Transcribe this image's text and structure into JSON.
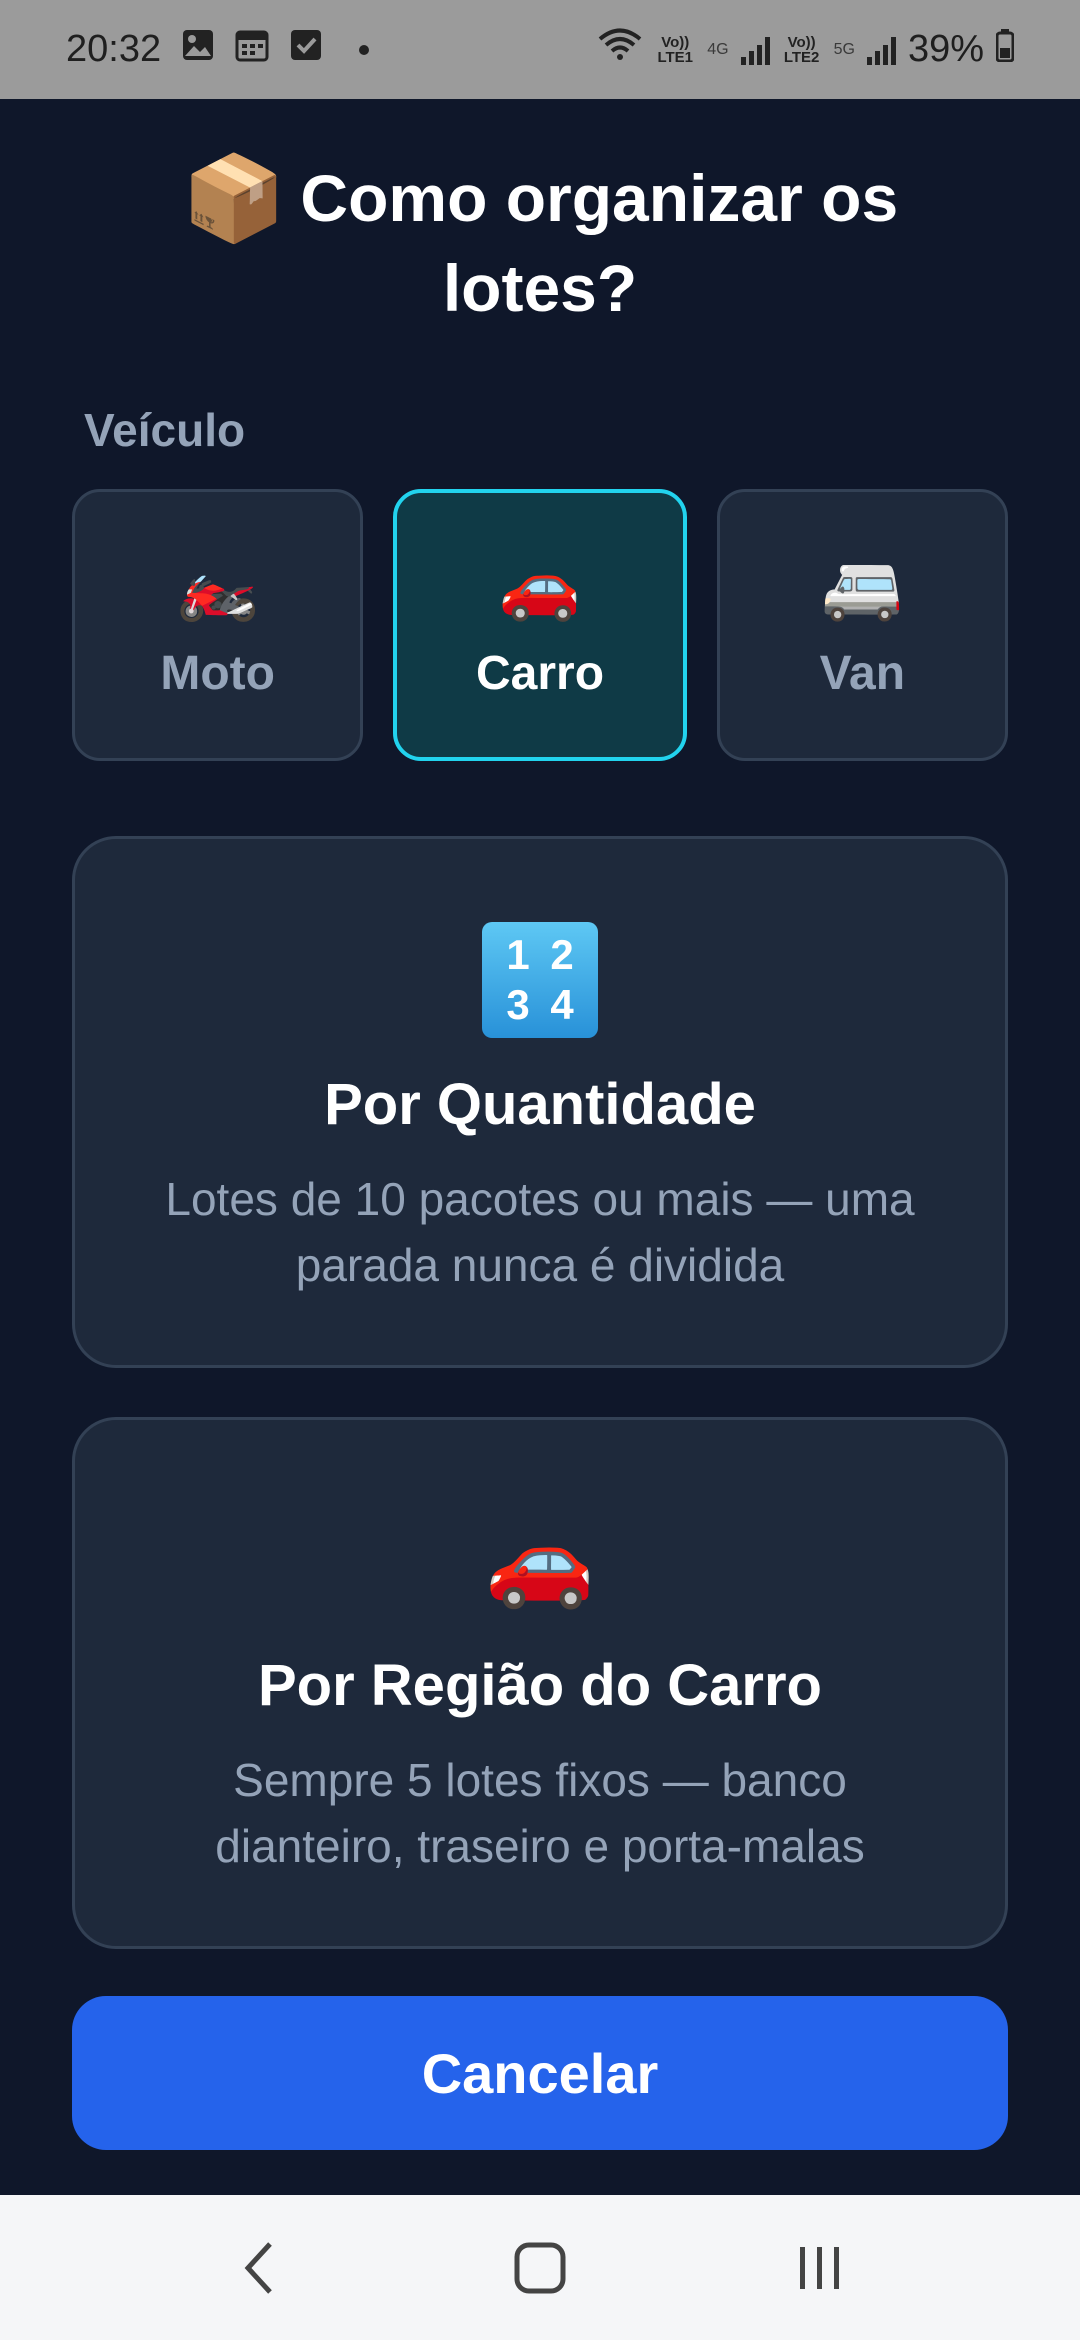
{
  "status_bar": {
    "time": "20:32",
    "left_icons": [
      "gallery-icon",
      "calendar-icon",
      "checkbox-icon",
      "dot-icon"
    ],
    "volte1": "Vo)) LTE1",
    "net1": "4G",
    "volte2": "Vo)) LTE2",
    "net2": "5G",
    "battery": "39%"
  },
  "header": {
    "emoji": "📦",
    "title": "Como organizar os lotes?"
  },
  "vehicle_section": {
    "label": "Veículo",
    "options": [
      {
        "emoji": "🏍️",
        "label": "Moto",
        "selected": false
      },
      {
        "emoji": "🚗",
        "label": "Carro",
        "selected": true
      },
      {
        "emoji": "🚐",
        "label": "Van",
        "selected": false
      }
    ]
  },
  "modes": [
    {
      "icon": "numbers-icon",
      "icon_digits": [
        "1",
        "2",
        "3",
        "4"
      ],
      "title": "Por Quantidade",
      "description": "Lotes de 10 pacotes ou mais — uma parada nunca é dividida"
    },
    {
      "icon": "car-icon",
      "icon_emoji": "🚗",
      "title": "Por Região do Carro",
      "description": "Sempre 5 lotes fixos — banco dianteiro, traseiro e porta-malas"
    }
  ],
  "actions": {
    "cancel_label": "Cancelar"
  },
  "colors": {
    "background": "#0f172a",
    "card": "#1e293b",
    "selected_border": "#22d3ee",
    "primary": "#2563eb"
  }
}
